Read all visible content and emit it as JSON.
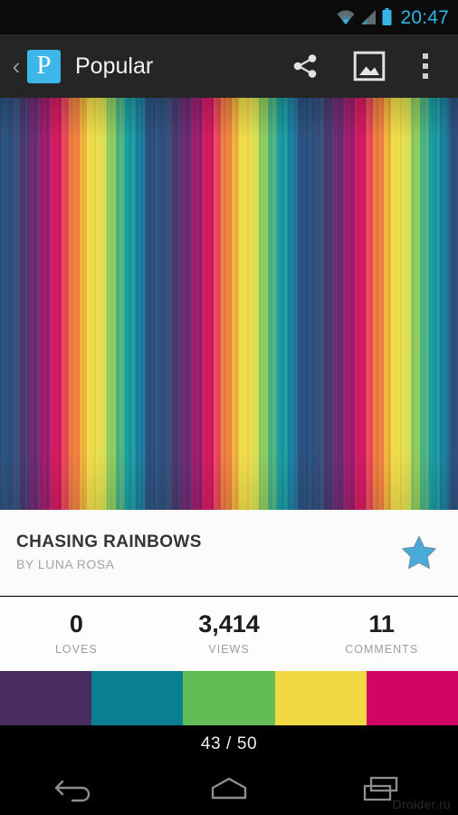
{
  "status_bar": {
    "time": "20:47",
    "icons": [
      "wifi-icon",
      "cellular-signal-icon",
      "battery-icon"
    ],
    "accent_color": "#33b5e5"
  },
  "action_bar": {
    "back_label": "‹",
    "app_logo_glyph": "P",
    "app_logo_color": "#3cb5e8",
    "title": "Popular",
    "background_color": "#252525",
    "actions": [
      {
        "name": "share-icon",
        "label": "Share"
      },
      {
        "name": "wallpaper-icon",
        "label": "Set wallpaper"
      },
      {
        "name": "overflow-menu-icon",
        "label": "More options"
      }
    ]
  },
  "wallpaper": {
    "name": "rainbow-stripes-preview",
    "description": "Vertical rainbow stripe pattern"
  },
  "pattern_info": {
    "title": "CHASING RAINBOWS",
    "author": "BY LUNA ROSA",
    "favorite_starred": true,
    "star_color": "#4aabdb"
  },
  "stats": [
    {
      "value": "0",
      "label": "LOVES"
    },
    {
      "value": "3,414",
      "label": "VIEWS"
    },
    {
      "value": "11",
      "label": "COMMENTS"
    }
  ],
  "palette": {
    "swatches": [
      {
        "name": "swatch-purple",
        "color": "#4a2d60"
      },
      {
        "name": "swatch-teal",
        "color": "#0a7f91"
      },
      {
        "name": "swatch-green",
        "color": "#62bd56"
      },
      {
        "name": "swatch-yellow",
        "color": "#f0d944"
      },
      {
        "name": "swatch-magenta",
        "color": "#d30564"
      }
    ]
  },
  "counter": {
    "text": "43 / 50",
    "current": 43,
    "total": 50
  },
  "nav_bar": {
    "buttons": [
      {
        "name": "nav-back-button",
        "label": "Back"
      },
      {
        "name": "nav-home-button",
        "label": "Home"
      },
      {
        "name": "nav-recents-button",
        "label": "Recents"
      }
    ]
  },
  "watermark": {
    "text": "Droider.ru"
  }
}
